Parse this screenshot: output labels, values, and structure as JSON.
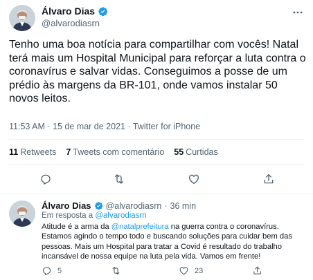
{
  "main_tweet": {
    "display_name": "Álvaro Dias",
    "handle": "@alvarodiasrn",
    "text": "Tenho uma boa notícia para compartilhar com vocês! Natal terá mais um Hospital Municipal para reforçar a luta contra o coronavírus e salvar vidas. Conseguimos a posse de um prédio às margens da BR-101, onde vamos instalar 50 novos leitos.",
    "time": "11:53 AM",
    "date": "15 de mar de 2021",
    "source": "Twitter for iPhone",
    "separator": "·",
    "stats": {
      "retweets_count": "11",
      "retweets_label": "Retweets",
      "quotes_count": "7",
      "quotes_label": "Tweets com comentário",
      "likes_count": "55",
      "likes_label": "Curtidas"
    }
  },
  "reply": {
    "display_name": "Álvaro Dias",
    "handle": "@alvarodiasrn",
    "time_ago": "36 min",
    "separator": "·",
    "replying_prefix": "Em resposta a",
    "replying_to": "@alvarodiasrn",
    "text_before_mention": "Atitude é a arma da",
    "mention": "@natalprefeitura",
    "text_after_mention": "na guerra contra o coronavírus. Estamos agindo o tempo todo e buscando soluções para cuidar bem das pessoas. Mais um Hospital para tratar a Covid é resultado do trabalho incansável de nossa equipe na luta pela vida. Vamos em frente!",
    "reply_count": "5",
    "like_count": "23"
  },
  "colors": {
    "verified_blue": "#1d9bf0",
    "link_blue": "#1d9bf0",
    "secondary_text": "#536471",
    "divider": "#eff3f4"
  },
  "icons": [
    "verified-badge",
    "more-icon",
    "reply-icon",
    "retweet-icon",
    "like-icon",
    "share-icon"
  ]
}
